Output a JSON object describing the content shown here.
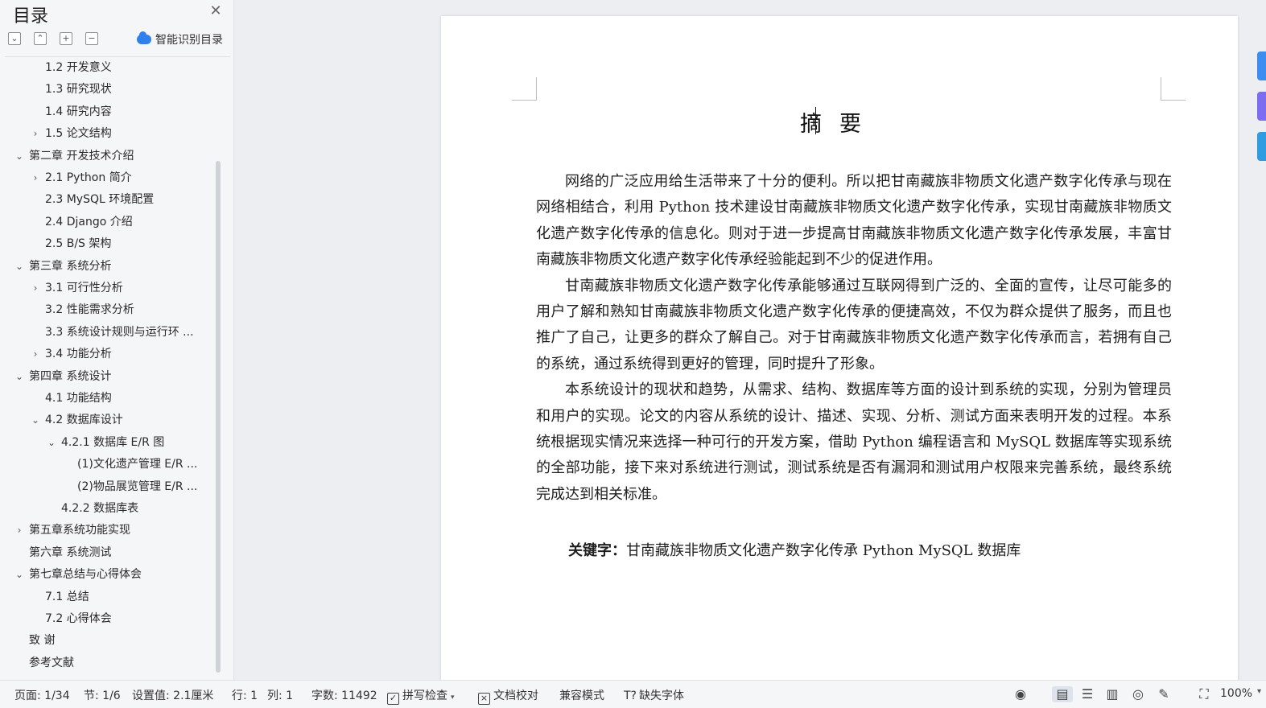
{
  "sidebar": {
    "title": "目录",
    "close_glyph": "✕",
    "tools": [
      "⌄",
      "⌃",
      "+",
      "−"
    ],
    "smart_toc_label": "智能识别目录",
    "items": [
      {
        "label": "1.2 开发意义",
        "level": 1,
        "chev": ""
      },
      {
        "label": "1.3 研究现状",
        "level": 1,
        "chev": ""
      },
      {
        "label": "1.4 研究内容",
        "level": 1,
        "chev": ""
      },
      {
        "label": "1.5 论文结构",
        "level": 1,
        "chev": "›"
      },
      {
        "label": "第二章 开发技术介绍",
        "level": 0,
        "chev": "⌄"
      },
      {
        "label": "2.1 Python 简介",
        "level": 1,
        "chev": "›"
      },
      {
        "label": "2.3 MySQL 环境配置",
        "level": 1,
        "chev": ""
      },
      {
        "label": "2.4 Django 介绍",
        "level": 1,
        "chev": ""
      },
      {
        "label": "2.5 B/S 架构",
        "level": 1,
        "chev": ""
      },
      {
        "label": "第三章  系统分析",
        "level": 0,
        "chev": "⌄"
      },
      {
        "label": "3.1 可行性分析",
        "level": 1,
        "chev": "›"
      },
      {
        "label": "3.2 性能需求分析",
        "level": 1,
        "chev": ""
      },
      {
        "label": "3.3 系统设计规则与运行环 ...",
        "level": 1,
        "chev": ""
      },
      {
        "label": "3.4 功能分析",
        "level": 1,
        "chev": "›"
      },
      {
        "label": "第四章  系统设计",
        "level": 0,
        "chev": "⌄"
      },
      {
        "label": "4.1 功能结构",
        "level": 1,
        "chev": ""
      },
      {
        "label": "4.2 数据库设计",
        "level": 1,
        "chev": "⌄"
      },
      {
        "label": "4.2.1 数据库 E/R 图",
        "level": 2,
        "chev": "⌄"
      },
      {
        "label": "(1)文化遗产管理 E/R ...",
        "level": 3,
        "chev": ""
      },
      {
        "label": "(2)物品展览管理 E/R ...",
        "level": 3,
        "chev": ""
      },
      {
        "label": "4.2.2  数据库表",
        "level": 2,
        "chev": ""
      },
      {
        "label": "第五章系统功能实现",
        "level": 0,
        "chev": "›"
      },
      {
        "label": "第六章  系统测试",
        "level": 0,
        "chev": ""
      },
      {
        "label": "第七章总结与心得体会",
        "level": 0,
        "chev": "⌄"
      },
      {
        "label": "7.1 总结",
        "level": 1,
        "chev": ""
      },
      {
        "label": "7.2 心得体会",
        "level": 1,
        "chev": ""
      },
      {
        "label": "致    谢",
        "level": 0,
        "chev": ""
      },
      {
        "label": "参考文献",
        "level": 0,
        "chev": ""
      }
    ]
  },
  "document": {
    "title": "摘要",
    "paragraphs": [
      "网络的广泛应用给生活带来了十分的便利。所以把甘南藏族非物质文化遗产数字化传承与现在网络相结合，利用 Python 技术建设甘南藏族非物质文化遗产数字化传承，实现甘南藏族非物质文化遗产数字化传承的信息化。则对于进一步提高甘南藏族非物质文化遗产数字化传承发展，丰富甘南藏族非物质文化遗产数字化传承经验能起到不少的促进作用。",
      "甘南藏族非物质文化遗产数字化传承能够通过互联网得到广泛的、全面的宣传，让尽可能多的用户了解和熟知甘南藏族非物质文化遗产数字化传承的便捷高效，不仅为群众提供了服务，而且也推广了自己，让更多的群众了解自己。对于甘南藏族非物质文化遗产数字化传承而言，若拥有自己的系统，通过系统得到更好的管理，同时提升了形象。",
      "本系统设计的现状和趋势，从需求、结构、数据库等方面的设计到系统的实现，分别为管理员和用户的实现。论文的内容从系统的设计、描述、实现、分析、测试方面来表明开发的过程。本系统根据现实情况来选择一种可行的开发方案，借助 Python 编程语言和 MySQL 数据库等实现系统的全部功能，接下来对系统进行测试，测试系统是否有漏洞和测试用户权限来完善系统，最终系统完成达到相关标准。"
    ],
    "keywords_label": "关键字：",
    "keywords_value": "甘南藏族非物质文化遗产数字化传承 Python   MySQL 数据库"
  },
  "right_tab_colors": [
    "#3d8cf0",
    "#7b6cf0",
    "#2f9be0"
  ],
  "statusbar": {
    "page": "页面: 1/34",
    "section": "节: 1/6",
    "setting": "设置值: 2.1厘米",
    "row": "行: 1",
    "col": "列: 1",
    "wordcount": "字数: 11492",
    "spellcheck": "拼写检查",
    "proofread": "文档校对",
    "compat": "兼容模式",
    "missing_font": "缺失字体",
    "zoom": "100%"
  }
}
